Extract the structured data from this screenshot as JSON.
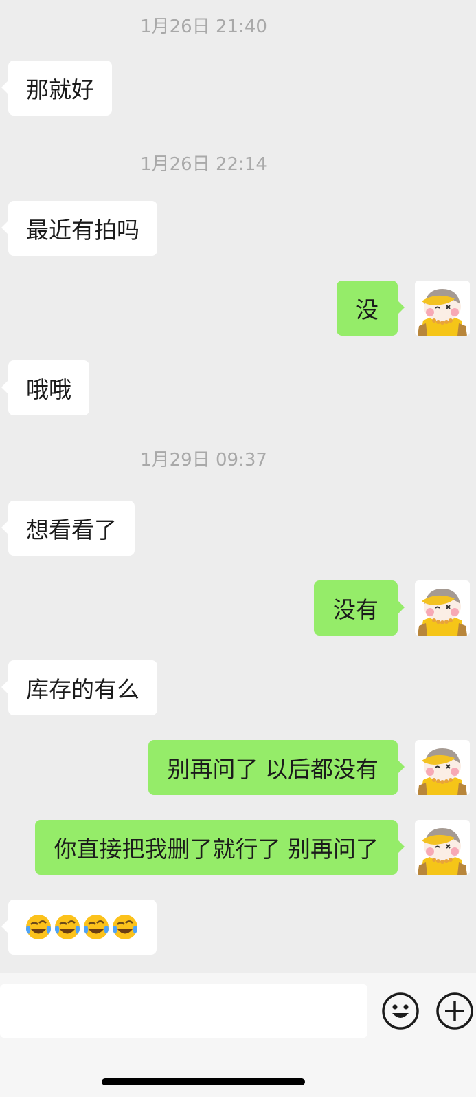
{
  "chat": {
    "timestamps": [
      "1月26日 21:40",
      "1月26日 22:14",
      "1月29日 09:37"
    ],
    "messages": [
      {
        "side": "left",
        "text": "那就好"
      },
      {
        "side": "left",
        "text": "最近有拍吗"
      },
      {
        "side": "right",
        "text": "没"
      },
      {
        "side": "left",
        "text": "哦哦"
      },
      {
        "side": "left",
        "text": "想看看了"
      },
      {
        "side": "right",
        "text": "没有"
      },
      {
        "side": "left",
        "text": "库存的有么"
      },
      {
        "side": "right",
        "text": "别再问了 以后都没有"
      },
      {
        "side": "right",
        "text": "你直接把我删了就行了 别再问了"
      },
      {
        "side": "left",
        "emoji": [
          "crying-laughing-face-emoji",
          "crying-laughing-face-emoji",
          "crying-laughing-face-emoji",
          "crying-laughing-face-emoji"
        ]
      }
    ]
  },
  "input_bar": {
    "value": "",
    "icons": [
      "smiley-face-icon",
      "plus-circle-icon"
    ]
  },
  "colors": {
    "background": "#ededed",
    "sent_bubble": "#95ec69",
    "received_bubble": "#ffffff",
    "timestamp_text": "#a9a9a9"
  }
}
